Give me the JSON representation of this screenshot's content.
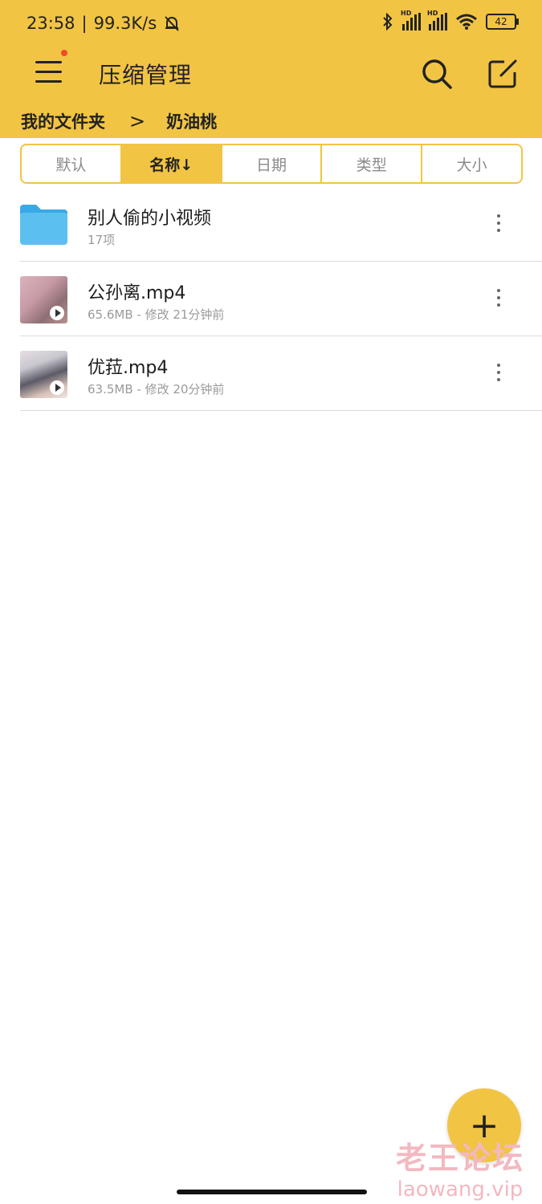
{
  "status_bar": {
    "time": "23:58",
    "network_speed": "99.3K/s",
    "signal_label": "HD",
    "battery": "42"
  },
  "app_bar": {
    "title": "压缩管理"
  },
  "breadcrumb": {
    "root": "我的文件夹",
    "separator": ">",
    "current": "奶油桃"
  },
  "sort_tabs": [
    {
      "label": "默认",
      "active": false
    },
    {
      "label": "名称↓",
      "active": true
    },
    {
      "label": "日期",
      "active": false
    },
    {
      "label": "类型",
      "active": false
    },
    {
      "label": "大小",
      "active": false
    }
  ],
  "files": [
    {
      "name": "别人偷的小视频",
      "meta": "17项",
      "type": "folder"
    },
    {
      "name": "公孙离.mp4",
      "meta": "65.6MB - 修改 21分钟前",
      "type": "video"
    },
    {
      "name": "优菈.mp4",
      "meta": "63.5MB - 修改 20分钟前",
      "type": "video"
    }
  ],
  "fab": {
    "label": "+"
  },
  "watermark": {
    "line1": "老王论坛",
    "line2": "laowang.vip"
  },
  "colors": {
    "accent": "#f1c443",
    "folder": "#5bc0f0"
  }
}
